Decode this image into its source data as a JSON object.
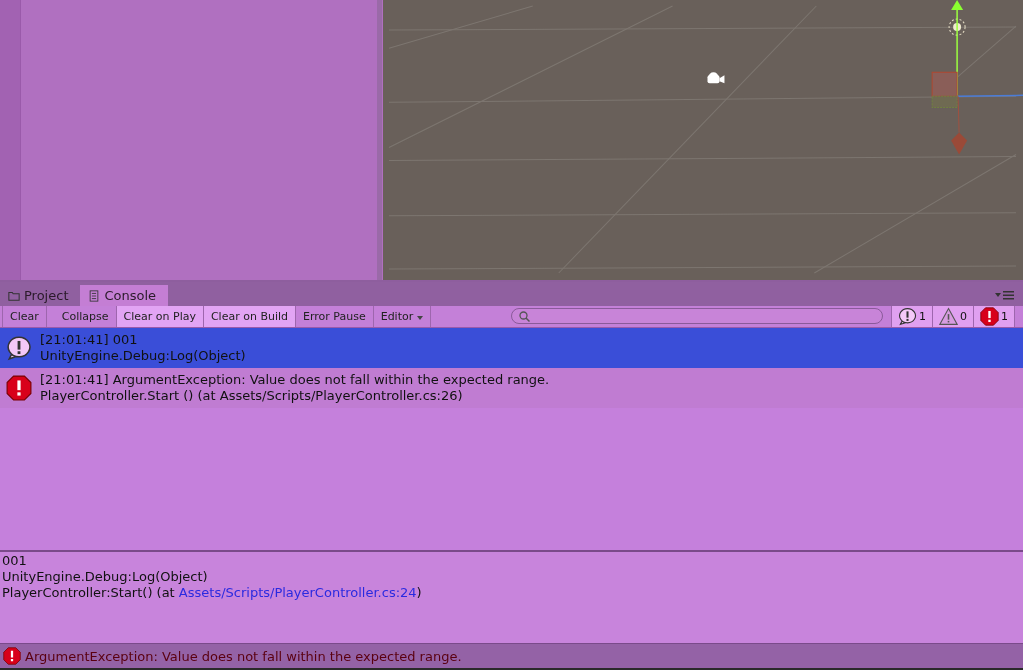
{
  "tabs": [
    {
      "label": "Project",
      "kind": "folder",
      "selected": false
    },
    {
      "label": "Console",
      "kind": "document",
      "selected": true
    }
  ],
  "toolbar": {
    "buttons": [
      {
        "label": "Clear",
        "kind": "button",
        "on": false
      },
      {
        "label": "Collapse",
        "kind": "toggle",
        "on": false
      },
      {
        "label": "Clear on Play",
        "kind": "toggle",
        "on": true
      },
      {
        "label": "Clear on Build",
        "kind": "toggle",
        "on": true
      },
      {
        "label": "Error Pause",
        "kind": "toggle",
        "on": false
      },
      {
        "label": "Editor",
        "kind": "dropdown",
        "on": false
      }
    ],
    "counters": [
      {
        "kind": "info",
        "count": "1",
        "on": true
      },
      {
        "kind": "warning",
        "count": "0",
        "on": true
      },
      {
        "kind": "error",
        "count": "1",
        "on": true
      }
    ]
  },
  "log_entries": [
    {
      "kind": "info",
      "selected": true,
      "line_1": "[21:01:41] 001",
      "line_2": "UnityEngine.Debug:Log(Object)"
    },
    {
      "kind": "error",
      "selected": false,
      "line_1": "[21:01:41] ArgumentException: Value does not fall within the expected range.",
      "line_2": "PlayerController.Start () (at Assets/Scripts/PlayerController.cs:26)"
    }
  ],
  "detail": {
    "lines": [
      "001",
      "UnityEngine.Debug:Log(Object)"
    ],
    "source": {
      "prefix": "PlayerController:Start() (at ",
      "link": "Assets/Scripts/PlayerController.cs:24",
      "suffix": ")"
    }
  },
  "status_bar": {
    "kind": "error",
    "message": "ArgumentException: Value does not fall within the expected range."
  }
}
